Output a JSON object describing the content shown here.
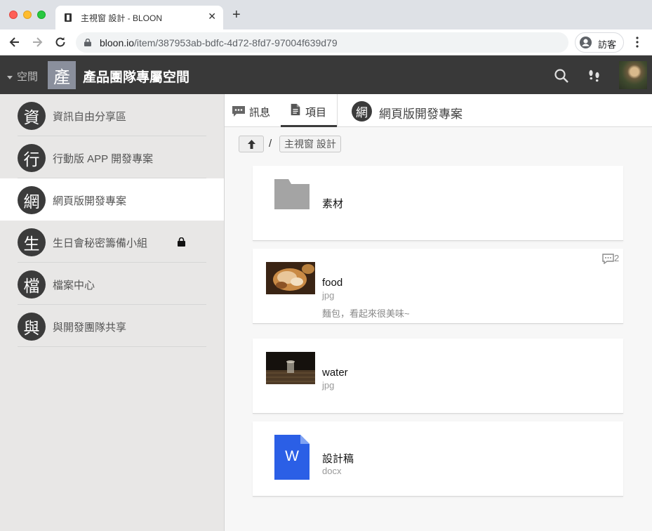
{
  "browser": {
    "tab_title": "主視窗 設計 - BLOON",
    "url_domain": "bloon.io",
    "url_path": "/item/387953ab-bdfc-4d72-8fd7-97004f639d79",
    "profile_label": "訪客"
  },
  "header": {
    "space_toggle_label": "空間",
    "space_avatar_char": "產",
    "space_title": "產品團隊專屬空間"
  },
  "sidebar": {
    "items": [
      {
        "avatar": "資",
        "label": "資訊自由分享區",
        "active": false,
        "locked": false
      },
      {
        "avatar": "行",
        "label": "行動版 APP 開發專案",
        "active": false,
        "locked": false
      },
      {
        "avatar": "網",
        "label": "網頁版開發專案",
        "active": true,
        "locked": false
      },
      {
        "avatar": "生",
        "label": "生日會秘密籌備小組",
        "active": false,
        "locked": true
      },
      {
        "avatar": "檔",
        "label": "檔案中心",
        "active": false,
        "locked": false
      },
      {
        "avatar": "與",
        "label": "與開發團隊共享",
        "active": false,
        "locked": false
      }
    ]
  },
  "main": {
    "tabs": [
      {
        "label": "訊息",
        "icon": "chat-icon",
        "active": false
      },
      {
        "label": "項目",
        "icon": "document-icon",
        "active": true
      }
    ],
    "channel": {
      "avatar": "網",
      "name": "網頁版開發專案"
    },
    "breadcrumb": {
      "separator": "/",
      "folder": "主視窗 設計"
    },
    "items": [
      {
        "type": "folder",
        "name": "素材",
        "ext": "",
        "desc": "",
        "comments": ""
      },
      {
        "type": "image",
        "thumb": "food",
        "name": "food",
        "ext": "jpg",
        "desc": "麵包，看起來很美味~",
        "comments": "2"
      },
      {
        "type": "image",
        "thumb": "water",
        "name": "water",
        "ext": "jpg",
        "desc": "",
        "comments": ""
      },
      {
        "type": "docx",
        "thumb_letter": "W",
        "name": "設計稿",
        "ext": "docx",
        "desc": "",
        "comments": ""
      }
    ]
  },
  "colors": {
    "header_bg": "#393939",
    "sidebar_bg": "#e8e7e6",
    "avatar_dark": "#3b3b3b",
    "word_blue": "#2b5fe6",
    "folder_gray": "#a4a4a4"
  }
}
